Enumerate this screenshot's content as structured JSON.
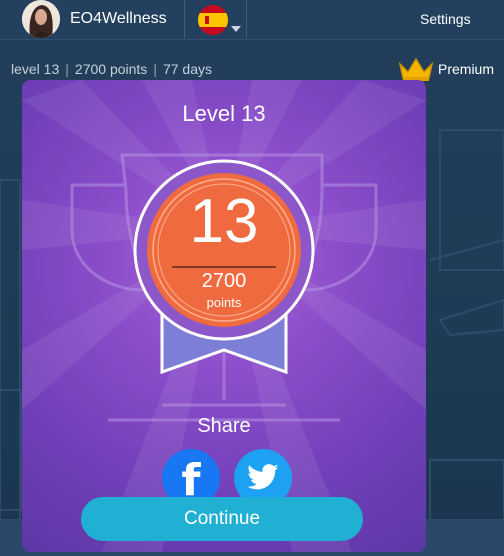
{
  "user": {
    "name": "EO4Wellness"
  },
  "header": {
    "settings_label": "Settings"
  },
  "stats": {
    "level": "level 13",
    "points": "2700 points",
    "days": "77 days"
  },
  "premium": {
    "label": "Premium"
  },
  "modal": {
    "title": "Level 13",
    "level_number": "13",
    "points_value": "2700",
    "points_label": "points",
    "share_label": "Share",
    "continue_label": "Continue"
  },
  "colors": {
    "modal_purple": "#8a4cc9",
    "badge_orange": "#f06a3f",
    "facebook": "#1877f2",
    "twitter": "#1da1f2",
    "continue": "#1fb0d4"
  },
  "icons": [
    "avatar-photo",
    "spain-flag-icon",
    "crown-icon",
    "trophy-icon",
    "facebook-icon",
    "twitter-icon"
  ]
}
